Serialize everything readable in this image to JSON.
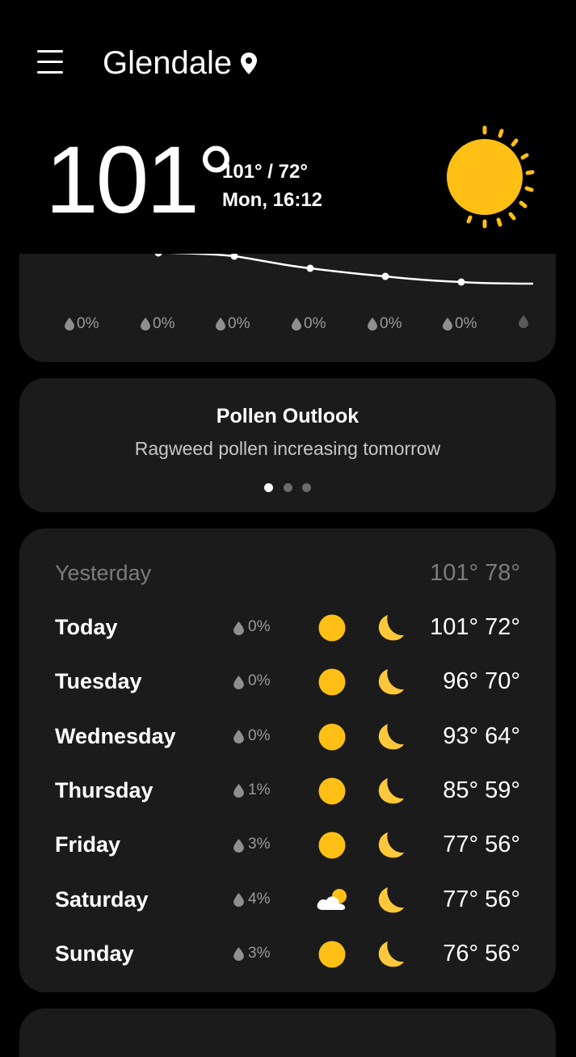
{
  "header": {
    "city": "Glendale",
    "menu_icon": "menu-icon",
    "location_icon": "location-pin-icon"
  },
  "current": {
    "temperature": "101°",
    "hi_lo": "101° / 72°",
    "datetime": "Mon, 16:12",
    "condition_icon": "sun-icon"
  },
  "hourly": {
    "precipitation": [
      "0%",
      "0%",
      "0%",
      "0%",
      "0%",
      "0%"
    ]
  },
  "pollen": {
    "title": "Pollen Outlook",
    "description": "Ragweed pollen increasing tomorrow",
    "page_count": 3,
    "active_page": 0
  },
  "daily": {
    "yesterday": {
      "label": "Yesterday",
      "temps": "101° 78°"
    },
    "days": [
      {
        "name": "Today",
        "precip": "0%",
        "day_icon": "sun-icon",
        "night_icon": "moon-icon",
        "temps": "101° 72°"
      },
      {
        "name": "Tuesday",
        "precip": "0%",
        "day_icon": "sun-icon",
        "night_icon": "moon-icon",
        "temps": "96° 70°"
      },
      {
        "name": "Wednesday",
        "precip": "0%",
        "day_icon": "sun-icon",
        "night_icon": "moon-icon",
        "temps": "93° 64°"
      },
      {
        "name": "Thursday",
        "precip": "1%",
        "day_icon": "sun-icon",
        "night_icon": "moon-icon",
        "temps": "85° 59°"
      },
      {
        "name": "Friday",
        "precip": "3%",
        "day_icon": "sun-icon",
        "night_icon": "moon-icon",
        "temps": "77° 56°"
      },
      {
        "name": "Saturday",
        "precip": "4%",
        "day_icon": "partly-cloudy-icon",
        "night_icon": "moon-icon",
        "temps": "77° 56°"
      },
      {
        "name": "Sunday",
        "precip": "3%",
        "day_icon": "sun-icon",
        "night_icon": "moon-icon",
        "temps": "76° 56°"
      }
    ]
  },
  "colors": {
    "background": "#000000",
    "card": "#1b1b1b",
    "sun": "#ffbf14",
    "moon": "#ffc83a",
    "muted_text": "#9a9a9a"
  }
}
